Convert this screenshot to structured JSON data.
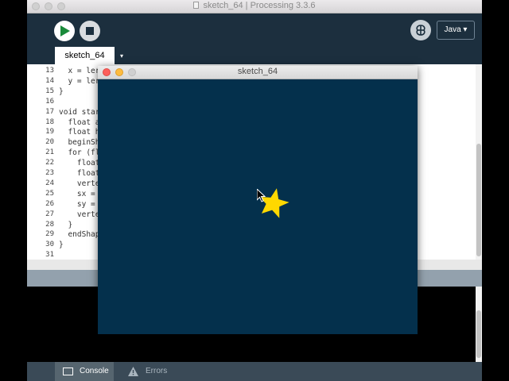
{
  "ide": {
    "window_title": "sketch_64 | Processing 3.3.6",
    "mode_label": "Java ▾",
    "tab_label": "sketch_64",
    "tab_menu_glyph": "▾"
  },
  "editor": {
    "lines": [
      {
        "num": "13",
        "code": "  x = ler"
      },
      {
        "num": "14",
        "code": "  y = ler"
      },
      {
        "num": "15",
        "code": "}"
      },
      {
        "num": "16",
        "code": ""
      },
      {
        "num": "17",
        "code": "void star"
      },
      {
        "num": "18",
        "code": "  float a"
      },
      {
        "num": "19",
        "code": "  float h"
      },
      {
        "num": "20",
        "code": "  beginSh"
      },
      {
        "num": "21",
        "code": "  for (fl"
      },
      {
        "num": "22",
        "code": "    float"
      },
      {
        "num": "23",
        "code": "    float"
      },
      {
        "num": "24",
        "code": "    verte"
      },
      {
        "num": "25",
        "code": "    sx = "
      },
      {
        "num": "26",
        "code": "    sy = "
      },
      {
        "num": "27",
        "code": "    verte"
      },
      {
        "num": "28",
        "code": "  }"
      },
      {
        "num": "29",
        "code": "  endShap"
      },
      {
        "num": "30",
        "code": "}"
      },
      {
        "num": "31",
        "code": ""
      }
    ]
  },
  "bottom_tabs": {
    "console_label": "Console",
    "errors_label": "Errors"
  },
  "sketch_window": {
    "title": "sketch_64"
  },
  "colors": {
    "ide_background": "#1c2f3e",
    "sketch_background": "#04304c",
    "star_fill": "#ffd800",
    "divider": "#93a1ad",
    "bottom_bar": "#3a4a57"
  },
  "icons": {
    "run": "play-icon",
    "stop": "stop-icon",
    "debug": "butterfly-debug-icon",
    "console": "console-icon",
    "errors": "warning-icon",
    "cursor": "arrow-cursor-icon",
    "star": "star-shape"
  }
}
